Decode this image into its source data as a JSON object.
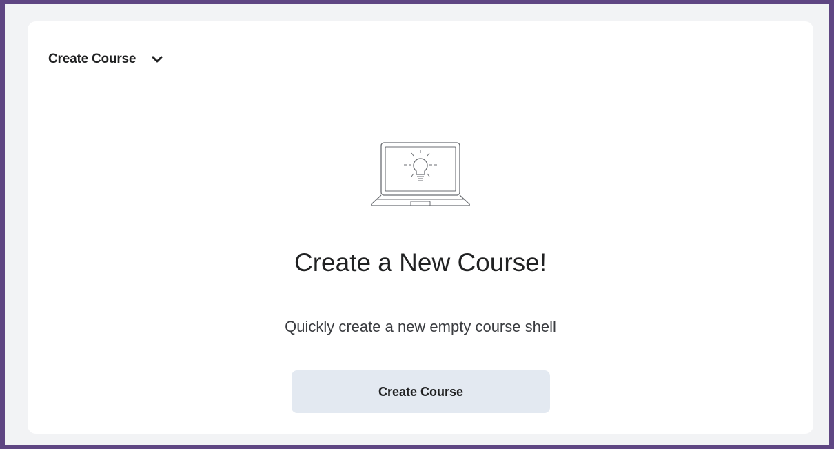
{
  "widget": {
    "title": "Create Course",
    "dropdown_icon": "chevron-down-icon"
  },
  "empty_state": {
    "illustration": "laptop-lightbulb-illustration",
    "heading": "Create a New Course!",
    "description": "Quickly create a new empty course shell",
    "button_label": "Create Course"
  },
  "colors": {
    "frame_border": "#5f4683",
    "card_background": "#ffffff",
    "button_background": "#e3e9f1",
    "text": "#202122"
  }
}
